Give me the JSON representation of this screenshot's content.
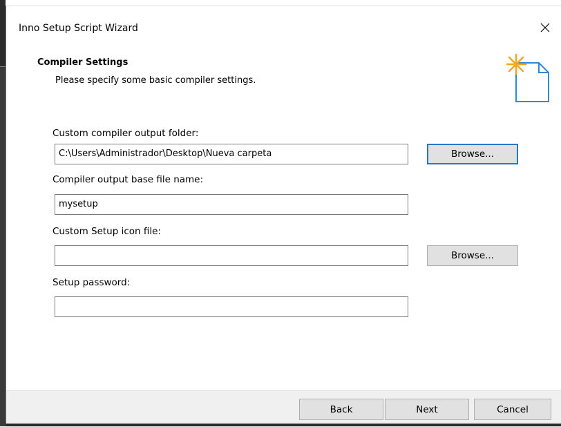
{
  "window": {
    "title": "Inno Setup Script Wizard"
  },
  "header": {
    "title": "Compiler Settings",
    "subtitle": "Please specify some basic compiler settings."
  },
  "fields": [
    {
      "label": "Custom compiler output folder:",
      "value": "C:\\Users\\Administrador\\Desktop\\Nueva carpeta",
      "has_browse": true
    },
    {
      "label": "Compiler output base file name:",
      "value": "mysetup",
      "has_browse": false
    },
    {
      "label": "Custom Setup icon file:",
      "value": "",
      "has_browse": true
    },
    {
      "label": "Setup password:",
      "value": "",
      "has_browse": false
    }
  ],
  "buttons": {
    "browse": "Browse...",
    "back": "Back",
    "next": "Next",
    "cancel": "Cancel"
  },
  "icons": {
    "close": "close-icon",
    "wizard": "new-file-star-icon"
  },
  "colors": {
    "focus_border": "#2e73c4",
    "footer_bg": "#f0f0f0",
    "button_bg": "#e1e1e1",
    "star": "#f5a623",
    "file_outline": "#2e88d8"
  }
}
